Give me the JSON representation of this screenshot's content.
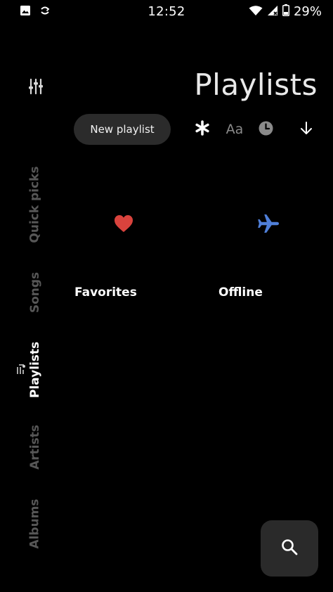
{
  "status_bar": {
    "time": "12:52",
    "battery": "29%",
    "icons": [
      "image-icon",
      "sync-icon",
      "wifi-icon",
      "signal-icon",
      "battery-icon"
    ]
  },
  "sidebar": {
    "settings_icon": "equalizer-sliders-icon",
    "items": [
      {
        "label": "Quick picks",
        "active": false
      },
      {
        "label": "Songs",
        "active": false
      },
      {
        "label": "Playlists",
        "active": true
      },
      {
        "label": "Artists",
        "active": false
      },
      {
        "label": "Albums",
        "active": false
      }
    ]
  },
  "header": {
    "title": "Playlists"
  },
  "toolbar": {
    "new_playlist_label": "New playlist",
    "sort_name_label": "Aa",
    "icons": [
      "asterisk-icon",
      "sort-by-name-icon",
      "clock-icon",
      "arrow-down-icon"
    ]
  },
  "playlists": [
    {
      "name": "Favorites",
      "icon": "heart-icon",
      "color": "#d9433d"
    },
    {
      "name": "Offline",
      "icon": "airplane-icon",
      "color": "#4f7fd8"
    }
  ],
  "fab": {
    "icon": "search-icon"
  },
  "colors": {
    "background": "#000000",
    "inactive_nav": "#575757",
    "button_bg": "#2b2b2b"
  }
}
